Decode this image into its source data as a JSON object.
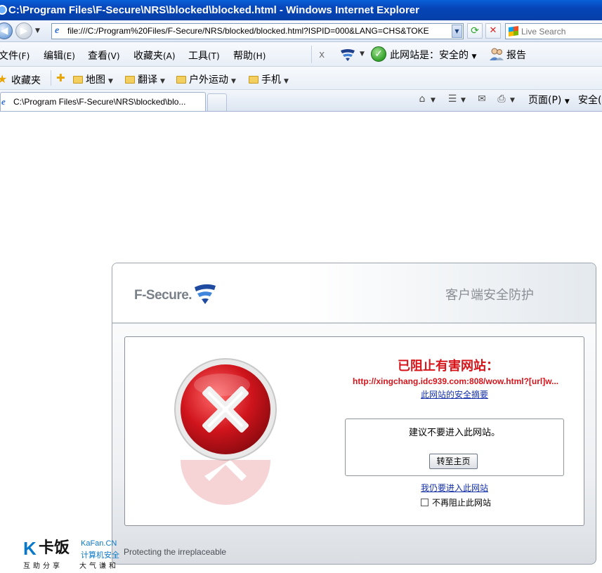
{
  "window": {
    "title": "C:\\Program Files\\F-Secure\\NRS\\blocked\\blocked.html - Windows Internet Explorer"
  },
  "address_bar": {
    "url": "file:///C:/Program%20Files/F-Secure/NRS/blocked/blocked.html?ISPID=000&LANG=CHS&TOKE",
    "search_placeholder": "Live Search"
  },
  "menu": {
    "items": [
      {
        "label": "文件",
        "accel": "(F)"
      },
      {
        "label": "编辑",
        "accel": "(E)"
      },
      {
        "label": "查看",
        "accel": "(V)"
      },
      {
        "label": "收藏夹",
        "accel": "(A)"
      },
      {
        "label": "工具",
        "accel": "(T)"
      },
      {
        "label": "帮助",
        "accel": "(H)"
      }
    ],
    "close_glyph": "x",
    "site_status": "此网站是：安全的",
    "report": "报告"
  },
  "favorites": {
    "label": "收藏夹",
    "folders": [
      "地图",
      "翻译",
      "户外运动",
      "手机"
    ]
  },
  "tabs": {
    "active_title": "C:\\Program Files\\F-Secure\\NRS\\blocked\\blo...",
    "page_menu": "页面(P)",
    "safety_menu": "安全("
  },
  "blocked_page": {
    "logo_text": "F-Secure.",
    "header_title": "客户端安全防护",
    "title": "已阻止有害网站：",
    "blocked_url": "http://xingchang.idc939.com:808/wow.html?[url]w...",
    "summary_link": "此网站的安全摘要",
    "advice": "建议不要进入此网站。",
    "home_button": "转至主页",
    "proceed_link": "我仍要进入此网站",
    "no_block_label": "不再阻止此网站",
    "tagline": "Protecting the irreplaceable"
  },
  "watermark": {
    "brand": "卡饭",
    "en": "KaFan.CN",
    "cn": "计算机安全",
    "sub1": "互助分享",
    "sub2": "大气谦和"
  },
  "colors": {
    "danger_red": "#d6141a",
    "link_blue": "#1530a8",
    "titlebar_blue": "#0745b8"
  }
}
